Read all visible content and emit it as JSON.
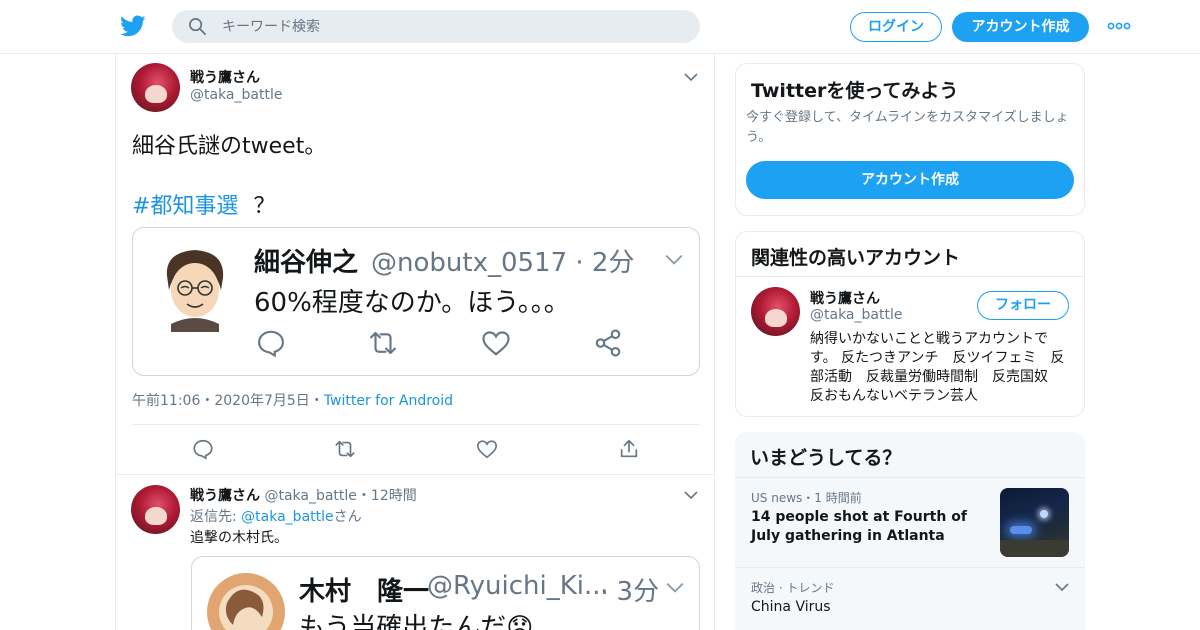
{
  "header": {
    "search_placeholder": "キーワード検索",
    "login_label": "ログイン",
    "signup_label": "アカウント作成"
  },
  "tweet": {
    "author_name": "戦う鷹さん",
    "author_handle": "@taka_battle",
    "text_line1": "細谷氏謎のtweet。",
    "hashtag": "#都知事選",
    "text_after_hashtag": "？",
    "quote": {
      "name": "細谷伸之",
      "handle": "@nobutx_0517 · 2分",
      "text": "60%程度なのか。ほう。。。"
    },
    "timestamp": "午前11:06・2020年7月5日・",
    "source": "Twitter for Android"
  },
  "reply": {
    "author_name": "戦う鷹さん",
    "author_handle": "@taka_battle",
    "time": "・12時間",
    "replying_to_prefix": "返信先: ",
    "replying_to_handle": "@taka_battle",
    "replying_to_suffix": "さん",
    "text": "追撃の木村氏。",
    "quote": {
      "name": "木村　隆一",
      "handle": "@Ryuichi_Ki...",
      "time": "· 3分",
      "text": "もう当確出たんだ😟"
    }
  },
  "signup_card": {
    "title": "Twitterを使ってみよう",
    "subtitle": "今すぐ登録して、タイムラインをカスタマイズしましょう。",
    "button": "アカウント作成"
  },
  "related": {
    "title": "関連性の高いアカウント",
    "name": "戦う鷹さん",
    "handle": "@taka_battle",
    "follow_label": "フォロー",
    "bio": "納得いかないことと戦うアカウントです。 反たつきアンチ　反ツイフェミ　反部活動　反裁量労働時間制　反売国奴　反おもんないベテラン芸人"
  },
  "trends": {
    "title": "いまどうしてる？",
    "items": [
      {
        "meta": "US news・1 時間前",
        "text": "14 people shot at Fourth of July gathering in Atlanta"
      },
      {
        "meta": "政治 · トレンド",
        "text": "China Virus"
      }
    ]
  },
  "colors": {
    "accent": "#1da1f2",
    "link": "#1b95e0",
    "muted": "#657786",
    "border": "#e6ecf0"
  }
}
